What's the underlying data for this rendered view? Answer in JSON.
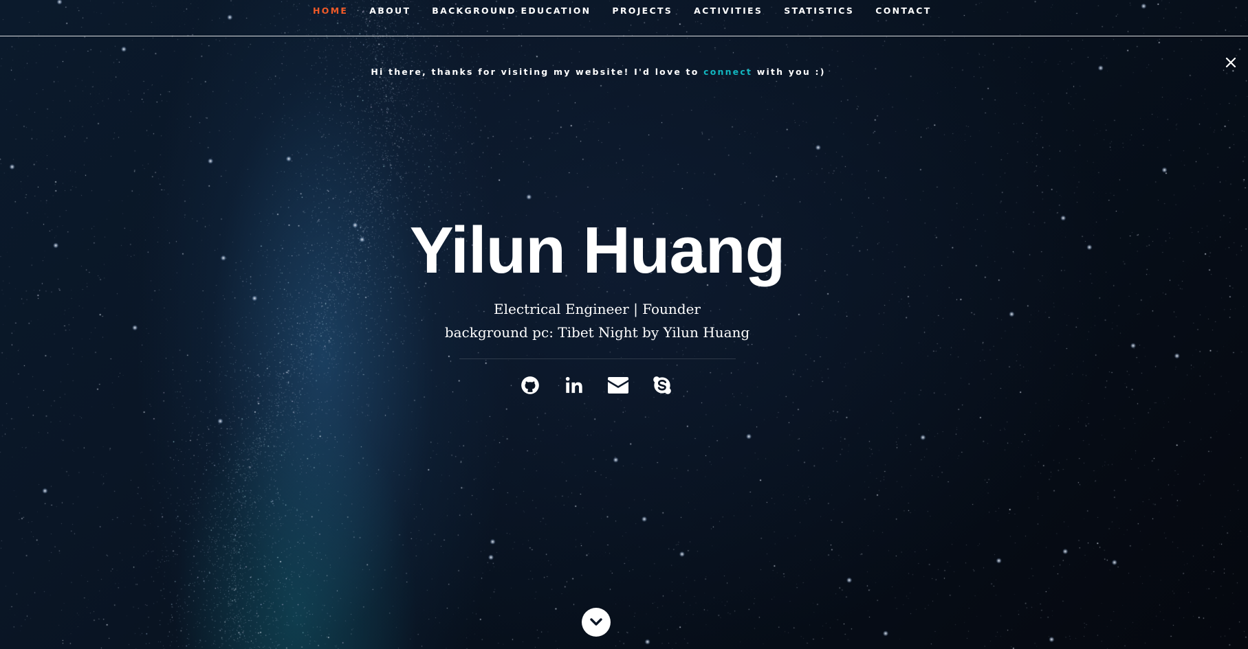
{
  "nav": {
    "items": [
      {
        "label": "HOME",
        "active": true
      },
      {
        "label": "ABOUT",
        "active": false
      },
      {
        "label": "BACKGROUND EDUCATION",
        "active": false
      },
      {
        "label": "PROJECTS",
        "active": false
      },
      {
        "label": "ACTIVITIES",
        "active": false
      },
      {
        "label": "STATISTICS",
        "active": false
      },
      {
        "label": "CONTACT",
        "active": false
      }
    ],
    "active_color": "#f05a28"
  },
  "notice": {
    "before": "Hi there, thanks for visiting my website! I'd love to ",
    "link": "connect",
    "after": " with you :)",
    "link_color": "#12b7c0",
    "close_icon": "close-icon"
  },
  "hero": {
    "name": "Yilun Huang",
    "subtitle": "Electrical Engineer | Founder",
    "credit": "background pc: Tibet Night by Yilun Huang"
  },
  "socials": [
    {
      "name": "github-icon"
    },
    {
      "name": "linkedin-icon"
    },
    {
      "name": "envelope-icon"
    },
    {
      "name": "skype-icon"
    }
  ],
  "scroll_icon": "chevron-down-icon"
}
